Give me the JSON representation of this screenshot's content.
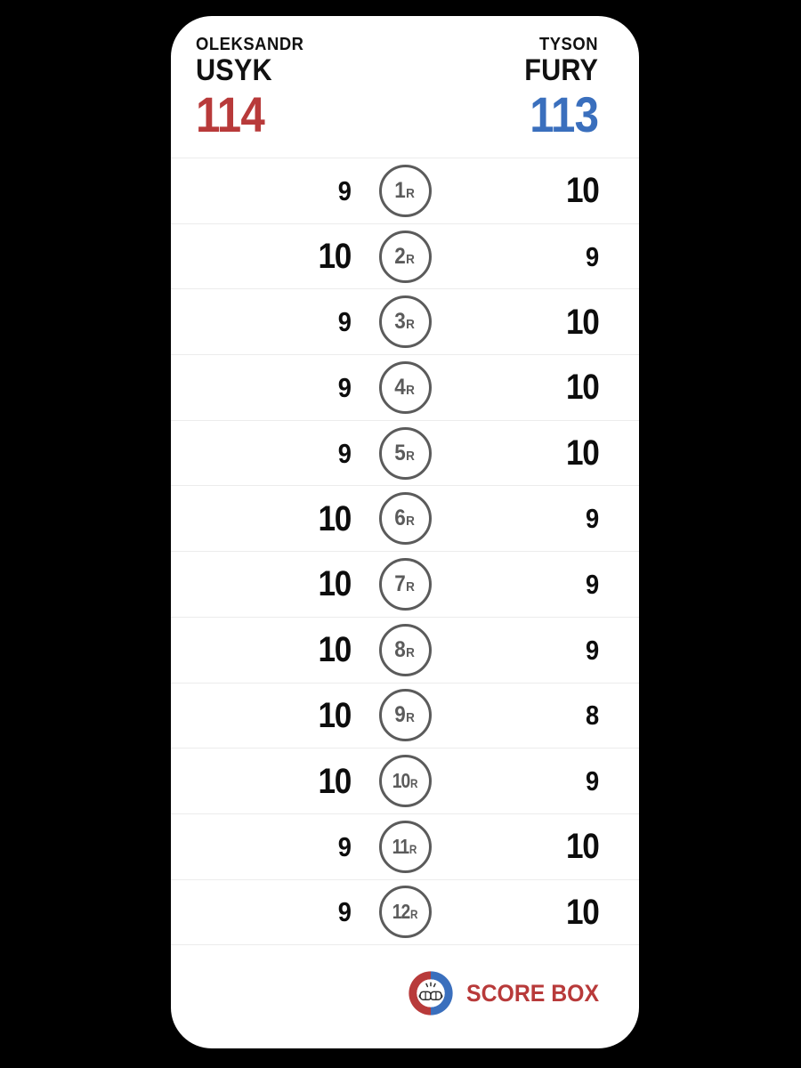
{
  "theme": {
    "background": "#000000",
    "card_background": "#ffffff",
    "red": "#b83a3a",
    "blue": "#3a6fbd",
    "text_dark": "#0d0d0d",
    "divider": "#ececec",
    "round_badge": "#5b5b5b"
  },
  "scorecard": {
    "left_fighter": {
      "first_name": "OLEKSANDR",
      "last_name": "USYK",
      "total": "114"
    },
    "right_fighter": {
      "first_name": "TYSON",
      "last_name": "FURY",
      "total": "113"
    },
    "round_suffix": "R",
    "rounds": [
      {
        "round": "1",
        "left": "9",
        "right": "10",
        "winner": "right"
      },
      {
        "round": "2",
        "left": "10",
        "right": "9",
        "winner": "left"
      },
      {
        "round": "3",
        "left": "9",
        "right": "10",
        "winner": "right"
      },
      {
        "round": "4",
        "left": "9",
        "right": "10",
        "winner": "right"
      },
      {
        "round": "5",
        "left": "9",
        "right": "10",
        "winner": "right"
      },
      {
        "round": "6",
        "left": "10",
        "right": "9",
        "winner": "left"
      },
      {
        "round": "7",
        "left": "10",
        "right": "9",
        "winner": "left"
      },
      {
        "round": "8",
        "left": "10",
        "right": "9",
        "winner": "left"
      },
      {
        "round": "9",
        "left": "10",
        "right": "8",
        "winner": "left"
      },
      {
        "round": "10",
        "left": "10",
        "right": "9",
        "winner": "left"
      },
      {
        "round": "11",
        "left": "9",
        "right": "10",
        "winner": "right"
      },
      {
        "round": "12",
        "left": "9",
        "right": "10",
        "winner": "right"
      }
    ]
  },
  "footer": {
    "brand_name": "SCORE BOX",
    "logo_icon": "boxing-gloves-ring-icon"
  }
}
